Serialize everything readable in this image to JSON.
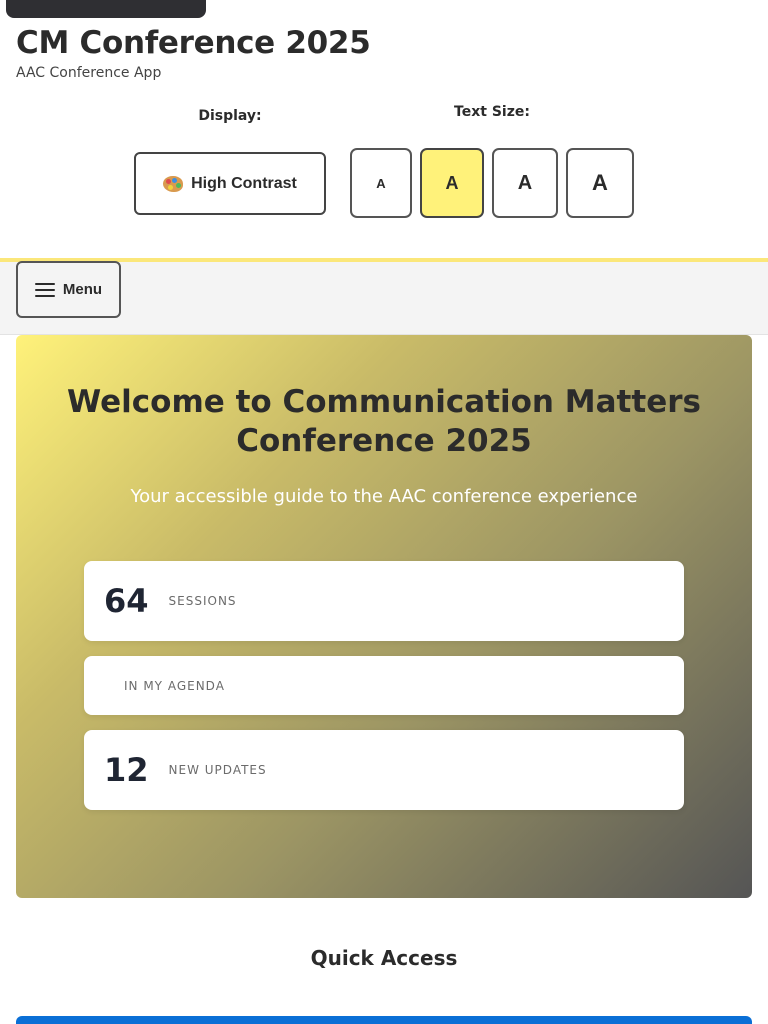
{
  "header": {
    "title": "CM Conference 2025",
    "subtitle": "AAC Conference App"
  },
  "display": {
    "label": "Display:",
    "contrast_button": "High Contrast",
    "contrast_icon": "palette-icon"
  },
  "text_size": {
    "label": "Text Size:",
    "options": [
      "A",
      "A",
      "A",
      "A"
    ],
    "selected_index": 1
  },
  "nav": {
    "menu_label": "Menu",
    "menu_icon": "hamburger-icon"
  },
  "hero": {
    "title": "Welcome to Communication Matters Conference 2025",
    "subtitle": "Your accessible guide to the AAC conference experience",
    "stats": [
      {
        "value": "64",
        "label": "SESSIONS"
      },
      {
        "value": "",
        "label": "IN MY AGENDA"
      },
      {
        "value": "12",
        "label": "NEW UPDATES"
      }
    ]
  },
  "quick_access": {
    "title": "Quick Access"
  },
  "colors": {
    "accent_yellow": "#fff27a",
    "primary_blue": "#0a6fd6",
    "dark_text": "#2b2b2b"
  }
}
